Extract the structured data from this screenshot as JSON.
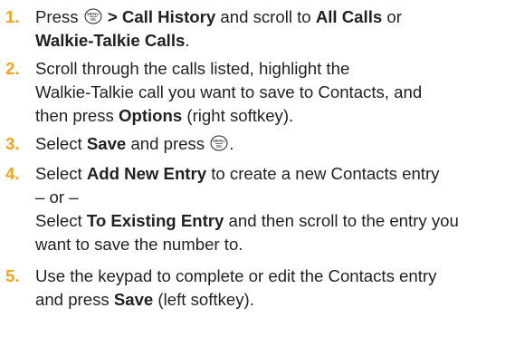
{
  "steps": [
    {
      "number": "1.",
      "line1_pre": "Press ",
      "line1_bold": "> Call History",
      "line1_mid": " and scroll to ",
      "line1_bold2": "All Calls",
      "line1_post": " or",
      "line2_bold": "Walkie-Talkie Calls",
      "line2_post": "."
    },
    {
      "number": "2.",
      "line1": "Scroll through the calls listed, highlight the",
      "line2": "Walkie-Talkie call you want to save to Contacts, and",
      "line3_pre": "then press ",
      "line3_bold": "Options",
      "line3_post": " (right softkey)."
    },
    {
      "number": "3.",
      "pre": "Select ",
      "bold": "Save",
      "mid": " and press ",
      "post": "."
    },
    {
      "number": "4.",
      "line1_pre": "Select ",
      "line1_bold": "Add New Entry",
      "line1_post": " to create a new Contacts entry",
      "line2": "– or –",
      "line3_pre": "Select ",
      "line3_bold": "To Existing Entry",
      "line3_post": " and then scroll to the entry you",
      "line4": "want to save the number to."
    },
    {
      "number": "5.",
      "line1": "Use the keypad to complete or edit the Contacts entry",
      "line2_pre": "and press ",
      "line2_bold": "Save",
      "line2_post": " (left softkey)."
    }
  ],
  "menu_key": {
    "top": "MENU",
    "bottom": "OK",
    "icon": "menu-ok-key-icon"
  },
  "colors": {
    "step_number": "#f5a31a",
    "text": "#231f20"
  }
}
